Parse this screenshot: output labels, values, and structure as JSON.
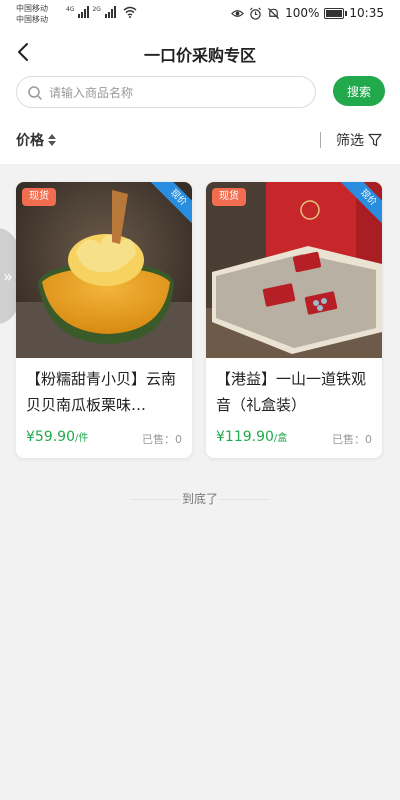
{
  "status_bar": {
    "carrier_1": "中国移动",
    "carrier_2": "中国移动",
    "signal_1_label": "4G",
    "signal_2_label": "2G",
    "battery_text": "100%",
    "time": "10:35"
  },
  "nav": {
    "title": "一口价采购专区"
  },
  "search": {
    "placeholder": "请输入商品名称",
    "value": "",
    "button_label": "搜索"
  },
  "filter": {
    "sort_label": "价格",
    "filter_label": "筛选"
  },
  "products": [
    {
      "stock_tag": "现货",
      "ribbon": "现价",
      "title": "【粉糯甜青小贝】云南贝贝南瓜板栗味…",
      "price": "¥59.90",
      "unit": "/件",
      "sold": "已售：0"
    },
    {
      "stock_tag": "现货",
      "ribbon": "现价",
      "title": "【港益】一山一道铁观音（礼盒装）",
      "price": "¥119.90",
      "unit": "/盒",
      "sold": "已售：0"
    }
  ],
  "footer": {
    "end_text": "到底了"
  },
  "colors": {
    "accent_green": "#22a94b",
    "tag_orange": "#f26c4f",
    "ribbon_blue": "#2a8ee0"
  },
  "icons": [
    "back-arrow-icon",
    "search-icon",
    "sort-arrows-icon",
    "filter-funnel-icon",
    "expand-chevrons-icon"
  ]
}
